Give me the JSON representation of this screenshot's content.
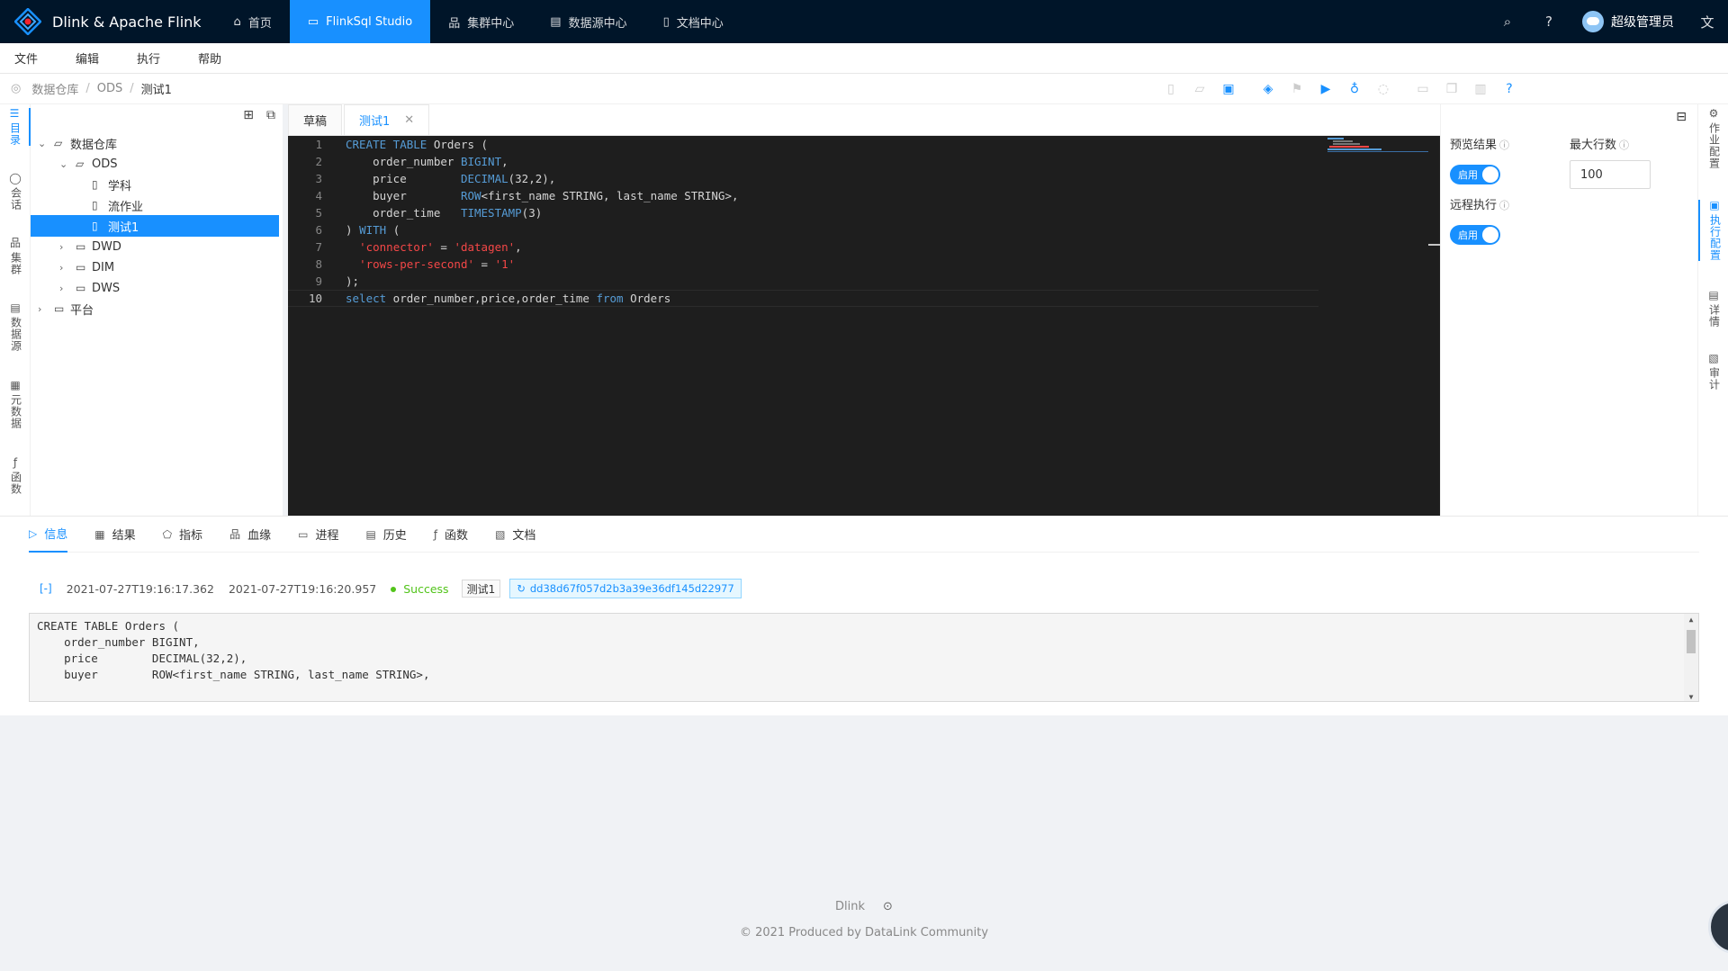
{
  "header": {
    "brand": "Dlink & Apache Flink",
    "nav": [
      {
        "label": "首页",
        "icon": "home-icon"
      },
      {
        "label": "FlinkSql Studio",
        "icon": "monitor-icon"
      },
      {
        "label": "集群中心",
        "icon": "cluster-icon"
      },
      {
        "label": "数据源中心",
        "icon": "database-icon"
      },
      {
        "label": "文档中心",
        "icon": "document-icon"
      }
    ],
    "user": "超级管理员"
  },
  "menu": [
    "文件",
    "编辑",
    "执行",
    "帮助"
  ],
  "breadcrumb": [
    "数据仓库",
    "ODS",
    "测试1"
  ],
  "left_tabs": [
    {
      "label": "目录",
      "icon": "bars-icon"
    },
    {
      "label": "会话",
      "icon": "message-icon"
    },
    {
      "label": "集群",
      "icon": "cluster-icon"
    },
    {
      "label": "数据源",
      "icon": "database-icon"
    },
    {
      "label": "元数据",
      "icon": "metadata-icon"
    },
    {
      "label": "函数",
      "icon": "function-icon"
    }
  ],
  "tree": {
    "root": "数据仓库",
    "ods": "ODS",
    "ods_children": [
      "学科",
      "流作业",
      "测试1"
    ],
    "siblings": [
      "DWD",
      "DIM",
      "DWS"
    ],
    "platform": "平台"
  },
  "editor": {
    "tabs": [
      "草稿",
      "测试1"
    ],
    "line_numbers": [
      "1",
      "2",
      "3",
      "4",
      "5",
      "6",
      "7",
      "8",
      "9",
      "10"
    ]
  },
  "config": {
    "preview_label": "预览结果",
    "preview_value": "启用",
    "max_rows_label": "最大行数",
    "max_rows_value": "100",
    "remote_label": "远程执行",
    "remote_value": "启用"
  },
  "right_tabs": [
    {
      "label": "作业配置",
      "icon": "setting-icon"
    },
    {
      "label": "执行配置",
      "icon": "schedule-icon"
    },
    {
      "label": "详情",
      "icon": "calendar-icon"
    },
    {
      "label": "审计",
      "icon": "audit-icon"
    }
  ],
  "console": {
    "tabs": [
      {
        "label": "信息",
        "icon": "code-icon"
      },
      {
        "label": "结果",
        "icon": "table-icon"
      },
      {
        "label": "指标",
        "icon": "radar-icon"
      },
      {
        "label": "血缘",
        "icon": "lineage-icon"
      },
      {
        "label": "进程",
        "icon": "desktop-icon"
      },
      {
        "label": "历史",
        "icon": "calendar-icon"
      },
      {
        "label": "函数",
        "icon": "function-icon"
      },
      {
        "label": "文档",
        "icon": "file-search-icon"
      }
    ],
    "start_time": "2021-07-27T19:16:17.362",
    "end_time": "2021-07-27T19:16:20.957",
    "status": "Success",
    "task_name": "测试1",
    "job_id": "dd38d67f057d2b3a39e36df145d22977",
    "sql_lines": [
      "CREATE TABLE Orders (",
      "    order_number BIGINT,",
      "    price        DECIMAL(32,2),",
      "    buyer        ROW<first_name STRING, last_name STRING>,"
    ]
  },
  "footer": {
    "link": "Dlink",
    "copyright": "2021 Produced by DataLink Community"
  },
  "colors": {
    "header_bg": "#001529",
    "accent": "#1890ff",
    "editor_bg": "#1e1e1e",
    "keyword": "#569cd6",
    "string": "#f44747",
    "success": "#52c41a"
  }
}
